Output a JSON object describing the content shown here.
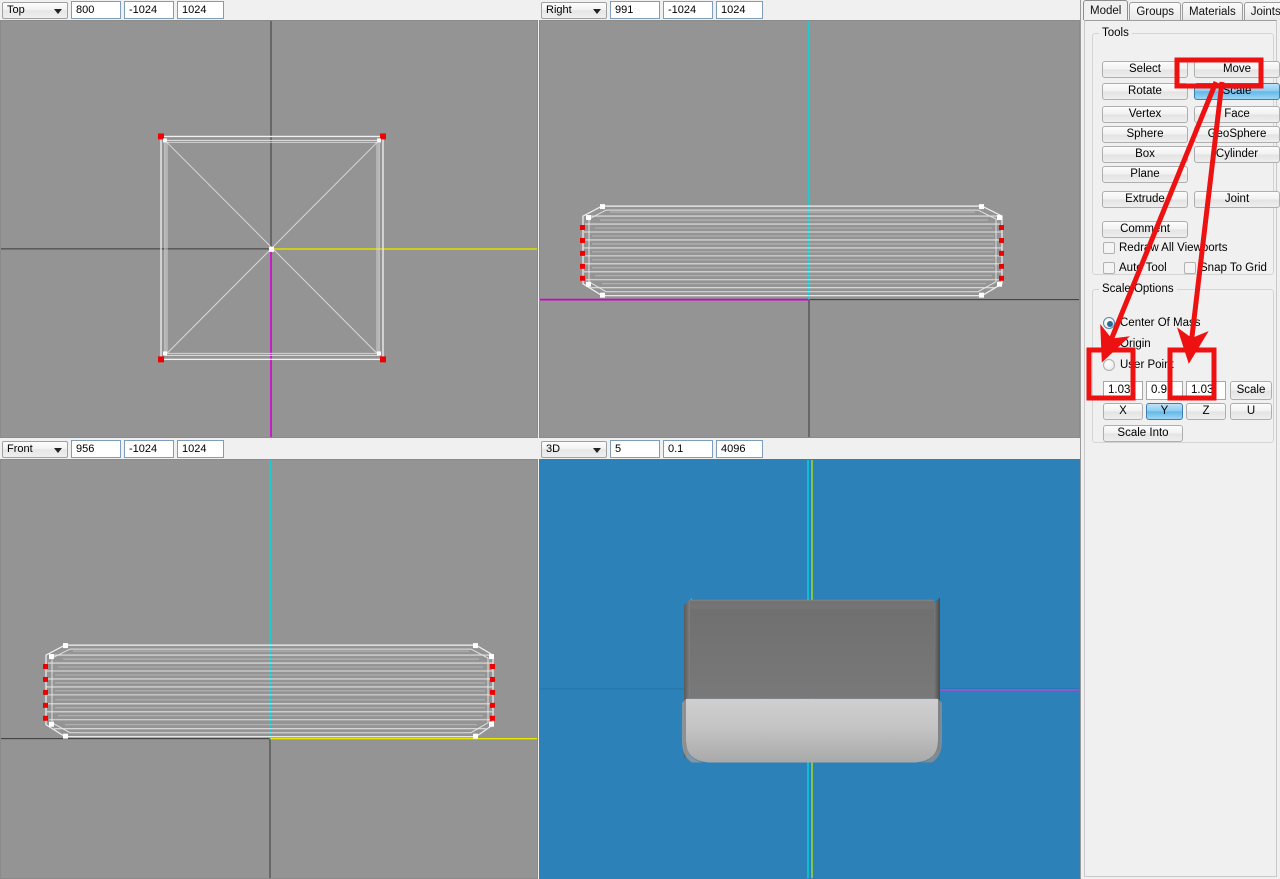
{
  "viewports": [
    {
      "id": "top-left",
      "view_label": "Top",
      "zoom_value": "800",
      "min_value": "-1024",
      "max_value": "1024",
      "background": "#949494",
      "shape": "wireframe-square-with-diagonals"
    },
    {
      "id": "top-right",
      "view_label": "Right",
      "zoom_value": "991",
      "min_value": "-1024",
      "max_value": "1024",
      "background": "#949494",
      "shape": "flattened-slab-wireframe"
    },
    {
      "id": "bottom-left",
      "view_label": "Front",
      "zoom_value": "956",
      "min_value": "-1024",
      "max_value": "1024",
      "background": "#949494",
      "shape": "flattened-slab-wireframe"
    },
    {
      "id": "bottom-right",
      "view_label": "3D",
      "zoom_value": "5",
      "min_value": "0.1",
      "max_value": "4096",
      "background": "#2b81b8",
      "shape": "shaded-rounded-slab"
    }
  ],
  "panel": {
    "tabs": [
      {
        "label": "Model",
        "active": true
      },
      {
        "label": "Groups",
        "active": false
      },
      {
        "label": "Materials",
        "active": false
      },
      {
        "label": "Joints",
        "active": false
      }
    ],
    "tools": {
      "legend": "Tools",
      "buttons": [
        {
          "label": "Select",
          "highlighted": false
        },
        {
          "label": "Move",
          "highlighted": false
        },
        {
          "label": "Rotate",
          "highlighted": false
        },
        {
          "label": "Scale",
          "highlighted": true
        },
        {
          "label": "Vertex",
          "highlighted": false
        },
        {
          "label": "Face",
          "highlighted": false
        },
        {
          "label": "Sphere",
          "highlighted": false
        },
        {
          "label": "GeoSphere",
          "highlighted": false
        },
        {
          "label": "Box",
          "highlighted": false
        },
        {
          "label": "Cylinder",
          "highlighted": false
        },
        {
          "label": "Plane",
          "highlighted": false
        },
        {
          "label": "Extrude",
          "highlighted": false
        },
        {
          "label": "Joint",
          "highlighted": false
        },
        {
          "label": "Comment",
          "highlighted": false
        }
      ],
      "checkboxes": [
        {
          "label": "Redraw All Viewports",
          "checked": false
        },
        {
          "label": "Auto Tool",
          "checked": false
        },
        {
          "label": "Snap To Grid",
          "checked": false
        }
      ]
    },
    "scale_options": {
      "legend": "Scale Options",
      "radios": [
        {
          "label": "Center Of Mass",
          "selected": true
        },
        {
          "label": "Origin",
          "selected": false
        },
        {
          "label": "User Point",
          "selected": false
        }
      ],
      "axis_fields": [
        {
          "axis_label": "X",
          "value": "1.03",
          "axis_active": false
        },
        {
          "axis_label": "Y",
          "value": "0.9",
          "axis_active": true
        },
        {
          "axis_label": "Z",
          "value": "1.03",
          "axis_active": false
        }
      ],
      "scale_button": "Scale",
      "uniform_button": "U",
      "scale_into_button": "Scale Into"
    }
  },
  "annotations": {
    "color": "#ee1111",
    "highlight_boxes": [
      {
        "target": "scale-tool-button"
      },
      {
        "target": "x-axis-field"
      },
      {
        "target": "z-axis-field"
      }
    ],
    "arrows": [
      {
        "from": "scale-tool-button",
        "to": "x-axis-field"
      },
      {
        "from": "scale-tool-button",
        "to": "z-axis-field"
      }
    ]
  },
  "colors": {
    "viewport_gray": "#949494",
    "viewport_blue": "#2b81b8",
    "axis_yellow": "#e8e800",
    "axis_magenta": "#d000d0",
    "axis_cyan": "#00d8e0",
    "axis_green": "#a8e020",
    "vertex_red": "#ee0000",
    "vertex_white": "#ffffff",
    "wire_white": "#f2f2f2",
    "annotation_red": "#ee1111",
    "highlight_blue": "#63b9e8"
  }
}
